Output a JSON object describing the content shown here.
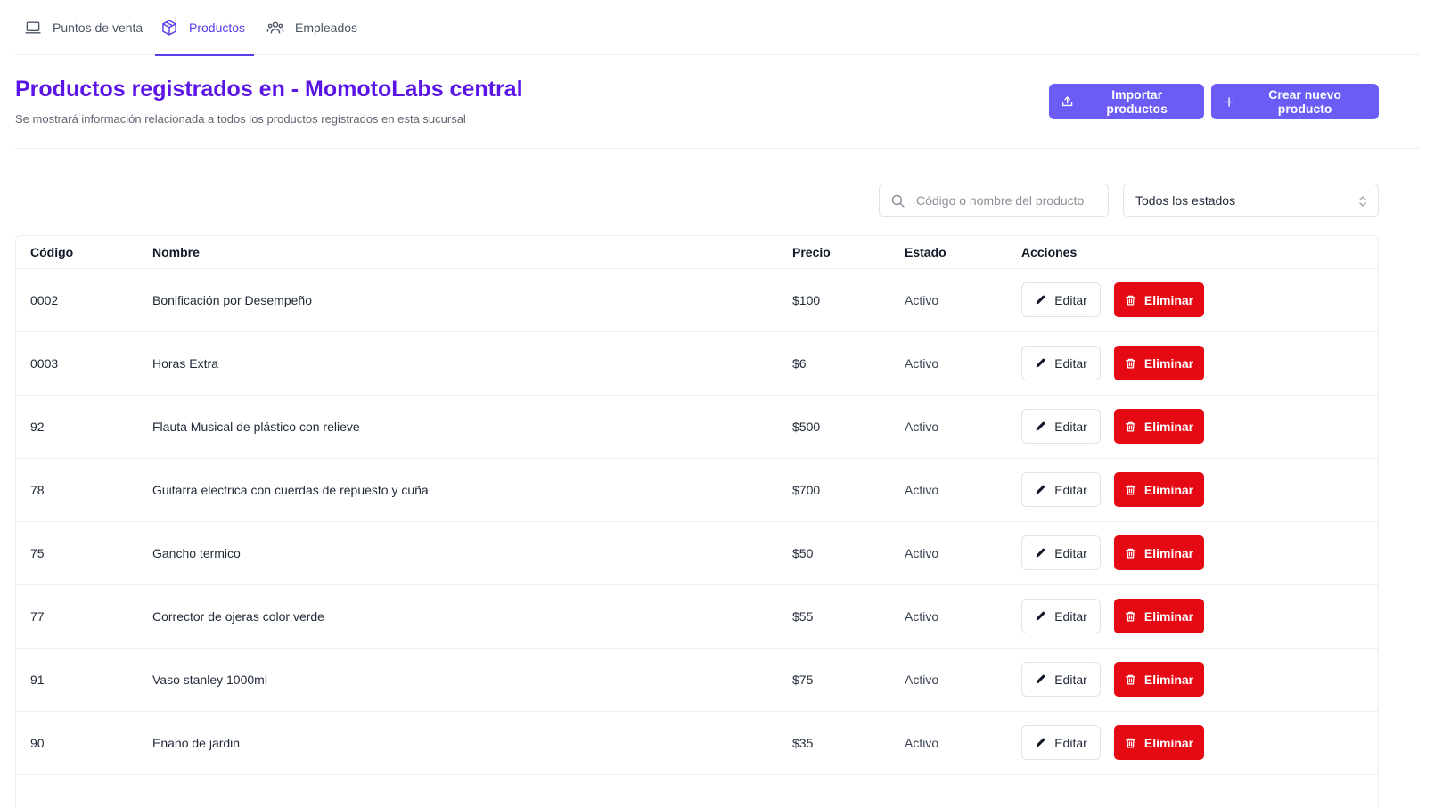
{
  "tabs": [
    {
      "label": "Puntos de venta",
      "icon": "laptop-icon"
    },
    {
      "label": "Productos",
      "icon": "box-icon",
      "active": true
    },
    {
      "label": "Empleados",
      "icon": "users-icon"
    }
  ],
  "header": {
    "title": "Productos registrados en - MomotoLabs central",
    "subtitle": "Se mostrará información relacionada a todos los productos registrados en esta sucursal",
    "import_label": "Importar productos",
    "create_label": "Crear nuevo producto"
  },
  "filters": {
    "search_placeholder": "Código o nombre del producto",
    "status_value": "Todos los estados"
  },
  "table": {
    "columns": [
      "Código",
      "Nombre",
      "Precio",
      "Estado",
      "Acciones"
    ],
    "edit_label": "Editar",
    "delete_label": "Eliminar",
    "rows": [
      {
        "code": "0002",
        "name": "Bonificación por Desempeño",
        "price": "$100",
        "status": "Activo"
      },
      {
        "code": "0003",
        "name": "Horas Extra",
        "price": "$6",
        "status": "Activo"
      },
      {
        "code": "92",
        "name": "Flauta Musical de plástico con relieve",
        "price": "$500",
        "status": "Activo"
      },
      {
        "code": "78",
        "name": "Guitarra electrica con cuerdas de repuesto y cuña",
        "price": "$700",
        "status": "Activo"
      },
      {
        "code": "75",
        "name": "Gancho termico",
        "price": "$50",
        "status": "Activo"
      },
      {
        "code": "77",
        "name": "Corrector de ojeras color verde",
        "price": "$55",
        "status": "Activo"
      },
      {
        "code": "91",
        "name": "Vaso stanley 1000ml",
        "price": "$75",
        "status": "Activo"
      },
      {
        "code": "90",
        "name": "Enano de jardin",
        "price": "$35",
        "status": "Activo"
      }
    ]
  },
  "colors": {
    "accent": "#5b3ce8",
    "title": "#5b14e6",
    "primary_button": "#6b5cf5",
    "danger": "#e50914"
  }
}
